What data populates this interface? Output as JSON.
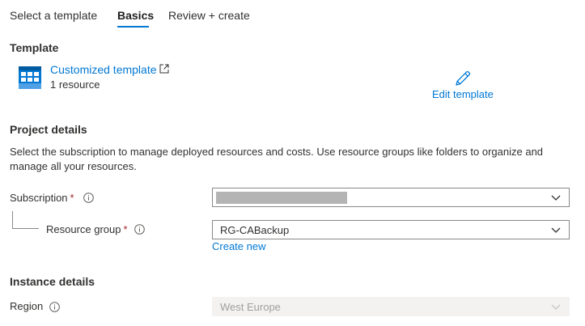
{
  "tabs": [
    {
      "label": "Select a template"
    },
    {
      "label": "Basics"
    },
    {
      "label": "Review + create"
    }
  ],
  "template": {
    "section_title": "Template",
    "name": "Customized template",
    "resource_count": "1 resource",
    "edit_label": "Edit template"
  },
  "project": {
    "section_title": "Project details",
    "description": "Select the subscription to manage deployed resources and costs. Use resource groups like folders to organize and manage all your resources.",
    "subscription_label": "Subscription",
    "subscription_value": "",
    "resource_group_label": "Resource group",
    "resource_group_value": "RG-CABackup",
    "create_new_label": "Create new"
  },
  "instance": {
    "section_title": "Instance details",
    "region_label": "Region",
    "region_value": "West Europe"
  },
  "colors": {
    "accent": "#0078d4",
    "required": "#a4262c",
    "redaction": "#b4b4b4"
  }
}
